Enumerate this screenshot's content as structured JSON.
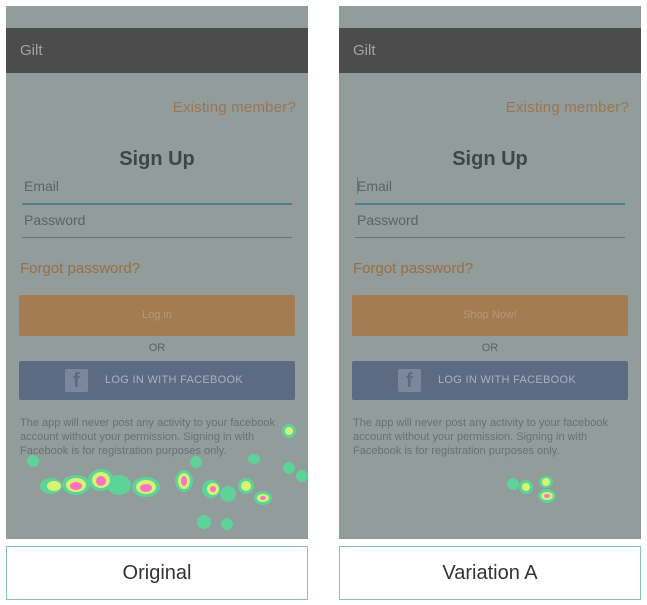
{
  "panels": [
    {
      "app_title": "Gilt",
      "existing_member": "Existing member?",
      "signup_title": "Sign Up",
      "email_placeholder": "Email",
      "password_placeholder": "Password",
      "forgot_password": "Forgot password?",
      "primary_button": "Log in",
      "or_label": "OR",
      "facebook_button": "LOG IN WITH FACEBOOK",
      "disclaimer": "The app will never post any activity to your facebook account without your permission. Signing in with Facebook is for registration purposes only.",
      "caption": "Original"
    },
    {
      "app_title": "Gilt",
      "existing_member": "Existing member?",
      "signup_title": "Sign Up",
      "email_placeholder": "Email",
      "password_placeholder": "Password",
      "forgot_password": "Forgot password?",
      "primary_button": "Shop Now!",
      "or_label": "OR",
      "facebook_button": "LOG IN WITH FACEBOOK",
      "disclaimer": "The app will never post any activity to your facebook account without your permission. Signing in with Facebook is for registration purposes only.",
      "caption": "Variation A"
    }
  ],
  "colors": {
    "heat_core": "#ff66cc",
    "heat_mid": "#ffff66",
    "heat_edge": "#33ff99"
  },
  "icons": {
    "facebook": "facebook-icon"
  }
}
